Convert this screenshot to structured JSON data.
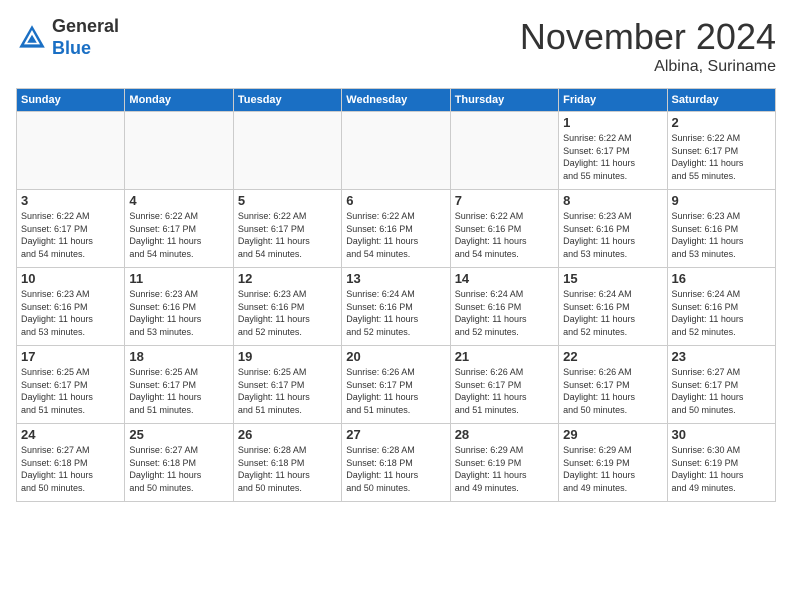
{
  "logo": {
    "general": "General",
    "blue": "Blue"
  },
  "title": "November 2024",
  "location": "Albina, Suriname",
  "headers": [
    "Sunday",
    "Monday",
    "Tuesday",
    "Wednesday",
    "Thursday",
    "Friday",
    "Saturday"
  ],
  "weeks": [
    [
      {
        "day": "",
        "info": ""
      },
      {
        "day": "",
        "info": ""
      },
      {
        "day": "",
        "info": ""
      },
      {
        "day": "",
        "info": ""
      },
      {
        "day": "",
        "info": ""
      },
      {
        "day": "1",
        "info": "Sunrise: 6:22 AM\nSunset: 6:17 PM\nDaylight: 11 hours\nand 55 minutes."
      },
      {
        "day": "2",
        "info": "Sunrise: 6:22 AM\nSunset: 6:17 PM\nDaylight: 11 hours\nand 55 minutes."
      }
    ],
    [
      {
        "day": "3",
        "info": "Sunrise: 6:22 AM\nSunset: 6:17 PM\nDaylight: 11 hours\nand 54 minutes."
      },
      {
        "day": "4",
        "info": "Sunrise: 6:22 AM\nSunset: 6:17 PM\nDaylight: 11 hours\nand 54 minutes."
      },
      {
        "day": "5",
        "info": "Sunrise: 6:22 AM\nSunset: 6:17 PM\nDaylight: 11 hours\nand 54 minutes."
      },
      {
        "day": "6",
        "info": "Sunrise: 6:22 AM\nSunset: 6:16 PM\nDaylight: 11 hours\nand 54 minutes."
      },
      {
        "day": "7",
        "info": "Sunrise: 6:22 AM\nSunset: 6:16 PM\nDaylight: 11 hours\nand 54 minutes."
      },
      {
        "day": "8",
        "info": "Sunrise: 6:23 AM\nSunset: 6:16 PM\nDaylight: 11 hours\nand 53 minutes."
      },
      {
        "day": "9",
        "info": "Sunrise: 6:23 AM\nSunset: 6:16 PM\nDaylight: 11 hours\nand 53 minutes."
      }
    ],
    [
      {
        "day": "10",
        "info": "Sunrise: 6:23 AM\nSunset: 6:16 PM\nDaylight: 11 hours\nand 53 minutes."
      },
      {
        "day": "11",
        "info": "Sunrise: 6:23 AM\nSunset: 6:16 PM\nDaylight: 11 hours\nand 53 minutes."
      },
      {
        "day": "12",
        "info": "Sunrise: 6:23 AM\nSunset: 6:16 PM\nDaylight: 11 hours\nand 52 minutes."
      },
      {
        "day": "13",
        "info": "Sunrise: 6:24 AM\nSunset: 6:16 PM\nDaylight: 11 hours\nand 52 minutes."
      },
      {
        "day": "14",
        "info": "Sunrise: 6:24 AM\nSunset: 6:16 PM\nDaylight: 11 hours\nand 52 minutes."
      },
      {
        "day": "15",
        "info": "Sunrise: 6:24 AM\nSunset: 6:16 PM\nDaylight: 11 hours\nand 52 minutes."
      },
      {
        "day": "16",
        "info": "Sunrise: 6:24 AM\nSunset: 6:16 PM\nDaylight: 11 hours\nand 52 minutes."
      }
    ],
    [
      {
        "day": "17",
        "info": "Sunrise: 6:25 AM\nSunset: 6:17 PM\nDaylight: 11 hours\nand 51 minutes."
      },
      {
        "day": "18",
        "info": "Sunrise: 6:25 AM\nSunset: 6:17 PM\nDaylight: 11 hours\nand 51 minutes."
      },
      {
        "day": "19",
        "info": "Sunrise: 6:25 AM\nSunset: 6:17 PM\nDaylight: 11 hours\nand 51 minutes."
      },
      {
        "day": "20",
        "info": "Sunrise: 6:26 AM\nSunset: 6:17 PM\nDaylight: 11 hours\nand 51 minutes."
      },
      {
        "day": "21",
        "info": "Sunrise: 6:26 AM\nSunset: 6:17 PM\nDaylight: 11 hours\nand 51 minutes."
      },
      {
        "day": "22",
        "info": "Sunrise: 6:26 AM\nSunset: 6:17 PM\nDaylight: 11 hours\nand 50 minutes."
      },
      {
        "day": "23",
        "info": "Sunrise: 6:27 AM\nSunset: 6:17 PM\nDaylight: 11 hours\nand 50 minutes."
      }
    ],
    [
      {
        "day": "24",
        "info": "Sunrise: 6:27 AM\nSunset: 6:18 PM\nDaylight: 11 hours\nand 50 minutes."
      },
      {
        "day": "25",
        "info": "Sunrise: 6:27 AM\nSunset: 6:18 PM\nDaylight: 11 hours\nand 50 minutes."
      },
      {
        "day": "26",
        "info": "Sunrise: 6:28 AM\nSunset: 6:18 PM\nDaylight: 11 hours\nand 50 minutes."
      },
      {
        "day": "27",
        "info": "Sunrise: 6:28 AM\nSunset: 6:18 PM\nDaylight: 11 hours\nand 50 minutes."
      },
      {
        "day": "28",
        "info": "Sunrise: 6:29 AM\nSunset: 6:19 PM\nDaylight: 11 hours\nand 49 minutes."
      },
      {
        "day": "29",
        "info": "Sunrise: 6:29 AM\nSunset: 6:19 PM\nDaylight: 11 hours\nand 49 minutes."
      },
      {
        "day": "30",
        "info": "Sunrise: 6:30 AM\nSunset: 6:19 PM\nDaylight: 11 hours\nand 49 minutes."
      }
    ]
  ]
}
